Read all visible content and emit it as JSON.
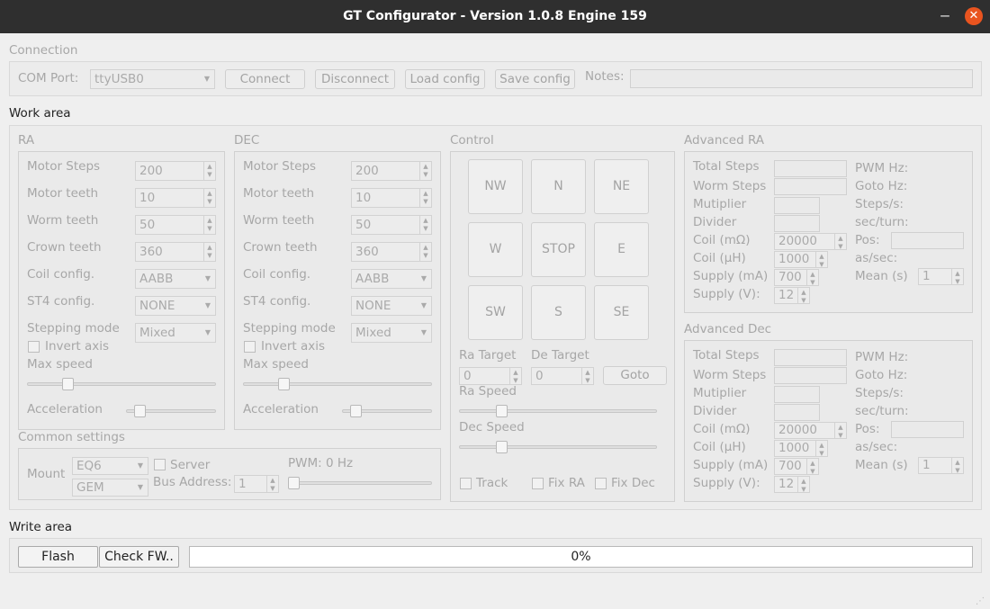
{
  "window": {
    "title": "GT Configurator - Version 1.0.8 Engine 159",
    "minimize": "‒",
    "close": "✕"
  },
  "connection": {
    "heading": "Connection",
    "com_label": "COM Port:",
    "com_value": "ttyUSB0",
    "connect": "Connect",
    "disconnect": "Disconnect",
    "load": "Load config",
    "save": "Save config",
    "notes_label": "Notes:",
    "notes_value": ""
  },
  "work": {
    "heading": "Work area",
    "ra": {
      "heading": "RA",
      "motor_steps_label": "Motor Steps",
      "motor_steps": "200",
      "motor_teeth_label": "Motor teeth",
      "motor_teeth": "10",
      "worm_teeth_label": "Worm teeth",
      "worm_teeth": "50",
      "crown_teeth_label": "Crown teeth",
      "crown_teeth": "360",
      "coil_label": "Coil config.",
      "coil": "AABB",
      "st4_label": "ST4 config.",
      "st4": "NONE",
      "stepping_label": "Stepping mode",
      "stepping": "Mixed",
      "invert_label": "Invert axis",
      "maxspeed_label": "Max speed",
      "accel_label": "Acceleration"
    },
    "dec": {
      "heading": "DEC",
      "motor_steps_label": "Motor Steps",
      "motor_steps": "200",
      "motor_teeth_label": "Motor teeth",
      "motor_teeth": "10",
      "worm_teeth_label": "Worm teeth",
      "worm_teeth": "50",
      "crown_teeth_label": "Crown teeth",
      "crown_teeth": "360",
      "coil_label": "Coil config.",
      "coil": "AABB",
      "st4_label": "ST4 config.",
      "st4": "NONE",
      "stepping_label": "Stepping mode",
      "stepping": "Mixed",
      "invert_label": "Invert axis",
      "maxspeed_label": "Max speed",
      "accel_label": "Acceleration"
    },
    "common": {
      "heading": "Common settings",
      "mount_label": "Mount",
      "mount": "EQ6",
      "mount_type": "GEM",
      "server_label": "Server",
      "bus_label": "Bus Address:",
      "bus": "1",
      "pwm_label": "PWM: 0 Hz"
    },
    "control": {
      "heading": "Control",
      "nw": "NW",
      "n": "N",
      "ne": "NE",
      "w": "W",
      "stop": "STOP",
      "e": "E",
      "sw": "SW",
      "s": "S",
      "se": "SE",
      "ra_target_label": "Ra Target",
      "ra_target": "0",
      "de_target_label": "De Target",
      "de_target": "0",
      "goto": "Goto",
      "ra_speed_label": "Ra Speed",
      "dec_speed_label": "Dec Speed",
      "track_label": "Track",
      "fixra_label": "Fix RA",
      "fixdec_label": "Fix Dec"
    },
    "adv_ra": {
      "heading": "Advanced RA",
      "total_steps_label": "Total Steps",
      "worm_steps_label": "Worm Steps",
      "multiplier_label": "Mutiplier",
      "divider_label": "Divider",
      "coil_r_label": "Coil (mΩ)",
      "coil_r": "20000",
      "coil_l_label": "Coil (μH)",
      "coil_l": "1000",
      "supply_ma_label": "Supply (mA)",
      "supply_ma": "700",
      "supply_v_label": "Supply (V):",
      "supply_v": "12",
      "pwm_label": "PWM Hz:",
      "goto_label": "Goto Hz:",
      "steps_label": "Steps/s:",
      "secturn_label": "sec/turn:",
      "pos_label": "Pos:",
      "assec_label": "as/sec:",
      "mean_label": "Mean (s)",
      "mean": "1"
    },
    "adv_dec": {
      "heading": "Advanced Dec",
      "total_steps_label": "Total Steps",
      "worm_steps_label": "Worm Steps",
      "multiplier_label": "Mutiplier",
      "divider_label": "Divider",
      "coil_r_label": "Coil (mΩ)",
      "coil_r": "20000",
      "coil_l_label": "Coil (μH)",
      "coil_l": "1000",
      "supply_ma_label": "Supply (mA)",
      "supply_ma": "700",
      "supply_v_label": "Supply (V):",
      "supply_v": "12",
      "pwm_label": "PWM Hz:",
      "goto_label": "Goto Hz:",
      "steps_label": "Steps/s:",
      "secturn_label": "sec/turn:",
      "pos_label": "Pos:",
      "assec_label": "as/sec:",
      "mean_label": "Mean (s)",
      "mean": "1"
    }
  },
  "write": {
    "heading": "Write area",
    "flash": "Flash",
    "check": "Check FW..",
    "progress": "0%",
    "progress_value": 0
  },
  "sliders": {
    "ra_max_speed": 0.2,
    "ra_accel": 0.1,
    "dec_max_speed": 0.2,
    "dec_accel": 0.1,
    "pwm": 0,
    "ra_speed": 0.2,
    "dec_speed": 0.2
  }
}
